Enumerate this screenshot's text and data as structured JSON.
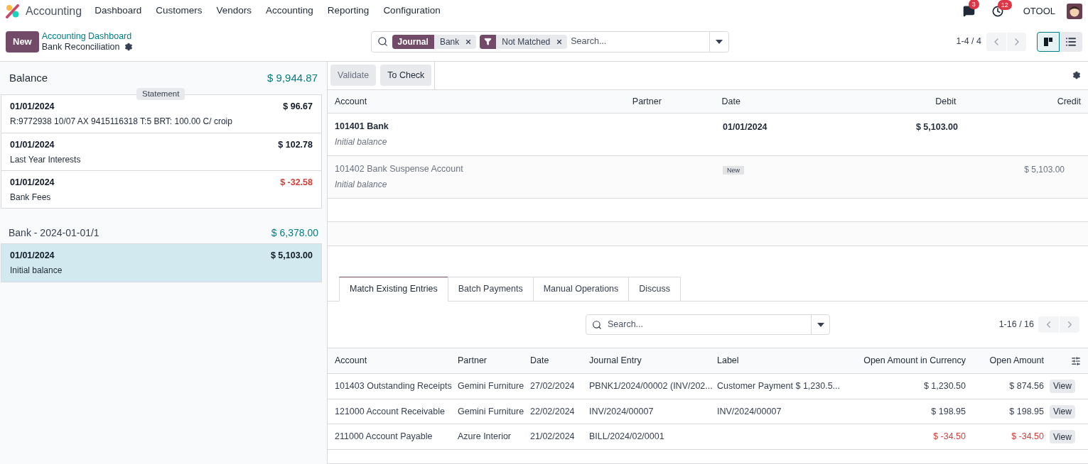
{
  "navbar": {
    "app": "Accounting",
    "menu": [
      "Dashboard",
      "Customers",
      "Vendors",
      "Accounting",
      "Reporting",
      "Configuration"
    ],
    "messages_badge": "3",
    "activities_badge": "12",
    "company": "OTOOL"
  },
  "control_panel": {
    "new_button": "New",
    "breadcrumb": "Accounting Dashboard",
    "title": "Bank Reconciliation",
    "facets": [
      {
        "kind": "field",
        "label": "Journal",
        "value": "Bank"
      },
      {
        "kind": "filter",
        "value": "Not Matched"
      }
    ],
    "search_placeholder": "Search...",
    "pager": "1-4 / 4",
    "views": [
      {
        "kind": "kanban",
        "selected": true
      },
      {
        "kind": "list",
        "selected": false
      }
    ]
  },
  "left": {
    "balance_label": "Balance",
    "balance": "$ 9,944.87",
    "statement_badge": "Statement",
    "groups": [
      {
        "lines": [
          {
            "date": "01/01/2024",
            "amount": "$ 96.67",
            "label": "R:9772938 10/07 AX 9415116318 T:5 BRT: 100.00 C/ croip",
            "negative": false,
            "selected": false
          },
          {
            "date": "01/01/2024",
            "amount": "$ 102.78",
            "label": "Last Year Interests",
            "negative": false,
            "selected": false
          },
          {
            "date": "01/01/2024",
            "amount": "$ -32.58",
            "label": "Bank Fees",
            "negative": true,
            "selected": false
          }
        ]
      },
      {
        "title": "Bank - 2024-01-01/1",
        "total": "$ 6,378.00",
        "lines": [
          {
            "date": "01/01/2024",
            "amount": "$ 5,103.00",
            "label": "Initial balance",
            "negative": false,
            "selected": true
          }
        ]
      }
    ]
  },
  "entry": {
    "buttons": [
      "Validate",
      "To Check"
    ],
    "columns": [
      "Account",
      "Partner",
      "Date",
      "Debit",
      "Credit"
    ],
    "rows": [
      {
        "kind": "main",
        "account": "101401 Bank",
        "label": "Initial balance",
        "date": "01/01/2024",
        "debit": "$ 5,103.00"
      },
      {
        "kind": "suspense",
        "account": "101402 Bank Suspense Account",
        "label": "Initial balance",
        "badge": "New",
        "credit": "$ 5,103.00"
      }
    ]
  },
  "tabs": [
    {
      "label": "Match Existing Entries",
      "selected": true
    },
    {
      "label": "Batch Payments",
      "selected": false
    },
    {
      "label": "Manual Operations",
      "selected": false
    },
    {
      "label": "Discuss",
      "selected": false
    }
  ],
  "match": {
    "search_placeholder": "Search...",
    "pager": "1-16 / 16",
    "columns": [
      "Account",
      "Partner",
      "Date",
      "Journal Entry",
      "Label",
      "Open Amount in Currency",
      "Open Amount"
    ],
    "rows": [
      {
        "cells": [
          "101403 Outstanding Receipts",
          "Gemini Furniture",
          "27/02/2024",
          "PBNK1/2024/00002 (INV/202...",
          "Customer Payment $ 1,230.5...",
          "$ 1,230.50",
          "$ 874.56"
        ],
        "negative": false,
        "action": "View"
      },
      {
        "cells": [
          "121000 Account Receivable",
          "Gemini Furniture",
          "22/02/2024",
          "INV/2024/00007",
          "INV/2024/00007",
          "$ 198.95",
          "$ 198.95"
        ],
        "negative": false,
        "action": "View"
      },
      {
        "cells": [
          "211000 Account Payable",
          "Azure Interior",
          "21/02/2024",
          "BILL/2024/02/0001",
          "",
          "$ -34.50",
          "$ -34.50"
        ],
        "negative": true,
        "action": "View"
      }
    ]
  }
}
